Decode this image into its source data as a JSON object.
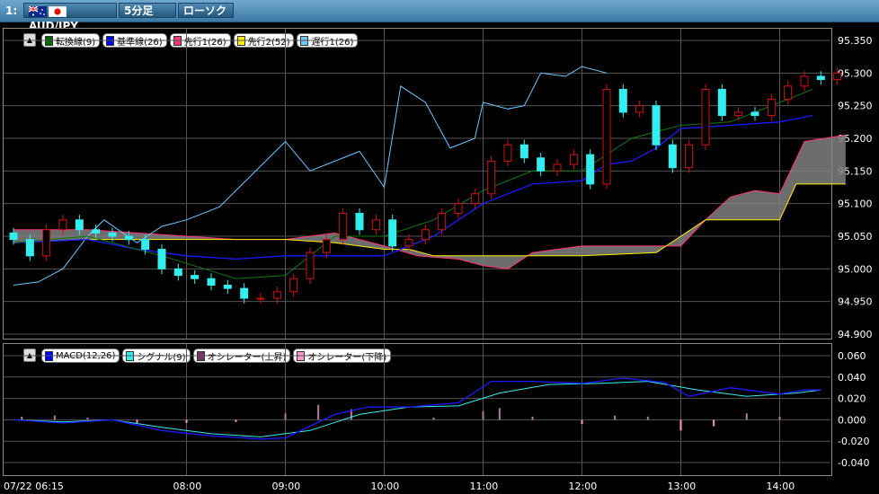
{
  "toolbar": {
    "index": "1:",
    "pair": "AUD/JPY",
    "interval": "5分足",
    "style": "ローソク"
  },
  "main_legend": [
    {
      "label": "転換線(9)",
      "color": "#006400"
    },
    {
      "label": "基準線(26)",
      "color": "#0000ff"
    },
    {
      "label": "先行1(26)",
      "color": "#ff3377"
    },
    {
      "label": "先行2(52)",
      "color": "#ffee00"
    },
    {
      "label": "遅行1(26)",
      "color": "#6ec8ff"
    }
  ],
  "sub_legend": [
    {
      "label": "MACD(12,26)",
      "color": "#0000ff"
    },
    {
      "label": "シグナル(9)",
      "color": "#33eeee"
    },
    {
      "label": "オシレーター(上昇)",
      "color": "#773366"
    },
    {
      "label": "オシレーター(下降)",
      "color": "#ff99cc"
    }
  ],
  "colors": {
    "bull": "#d41010",
    "bear": "#33eeee",
    "cloud": "#808080"
  },
  "chart_data": [
    {
      "type": "candlestick",
      "title": "AUD/JPY 5分足",
      "ylim": [
        94.88,
        95.37
      ],
      "y_ticks": [
        "95.350",
        "95.300",
        "95.250",
        "95.200",
        "95.150",
        "95.100",
        "95.050",
        "95.000",
        "94.950",
        "94.900"
      ],
      "x_ticks": [
        "07/22 06:15",
        "08:00",
        "09:00",
        "10:00",
        "11:00",
        "12:00",
        "13:00",
        "14:00"
      ],
      "x_range": [
        "06:15",
        "14:40"
      ],
      "close_series": [
        [
          "06:15",
          95.045
        ],
        [
          "06:25",
          95.02
        ],
        [
          "06:35",
          95.06
        ],
        [
          "06:45",
          95.075
        ],
        [
          "06:55",
          95.06
        ],
        [
          "07:05",
          95.055
        ],
        [
          "07:15",
          95.05
        ],
        [
          "07:25",
          95.045
        ],
        [
          "07:35",
          95.03
        ],
        [
          "07:45",
          95.0
        ],
        [
          "07:55",
          94.99
        ],
        [
          "08:05",
          94.985
        ],
        [
          "08:15",
          94.975
        ],
        [
          "08:25",
          94.97
        ],
        [
          "08:35",
          94.955
        ],
        [
          "08:45",
          94.955
        ],
        [
          "08:55",
          94.965
        ],
        [
          "09:05",
          94.985
        ],
        [
          "09:15",
          95.025
        ],
        [
          "09:25",
          95.045
        ],
        [
          "09:35",
          95.085
        ],
        [
          "09:45",
          95.06
        ],
        [
          "09:55",
          95.075
        ],
        [
          "10:05",
          95.035
        ],
        [
          "10:15",
          95.045
        ],
        [
          "10:25",
          95.06
        ],
        [
          "10:35",
          95.085
        ],
        [
          "10:45",
          95.1
        ],
        [
          "10:55",
          95.115
        ],
        [
          "11:05",
          95.165
        ],
        [
          "11:15",
          95.19
        ],
        [
          "11:25",
          95.17
        ],
        [
          "11:35",
          95.15
        ],
        [
          "11:45",
          95.16
        ],
        [
          "11:55",
          95.175
        ],
        [
          "12:05",
          95.13
        ],
        [
          "12:15",
          95.275
        ],
        [
          "12:25",
          95.24
        ],
        [
          "12:35",
          95.25
        ],
        [
          "12:45",
          95.19
        ],
        [
          "12:55",
          95.155
        ],
        [
          "13:05",
          95.19
        ],
        [
          "13:15",
          95.275
        ],
        [
          "13:25",
          95.235
        ],
        [
          "13:35",
          95.24
        ],
        [
          "13:45",
          95.235
        ],
        [
          "13:55",
          95.26
        ],
        [
          "14:05",
          95.28
        ],
        [
          "14:15",
          95.295
        ],
        [
          "14:25",
          95.29
        ],
        [
          "14:35",
          95.3
        ]
      ],
      "kijun_26": [
        [
          "06:15",
          95.04
        ],
        [
          "07:00",
          95.045
        ],
        [
          "07:30",
          95.03
        ],
        [
          "08:00",
          95.02
        ],
        [
          "08:30",
          95.015
        ],
        [
          "09:00",
          95.02
        ],
        [
          "09:30",
          95.02
        ],
        [
          "10:00",
          95.02
        ],
        [
          "10:30",
          95.05
        ],
        [
          "11:00",
          95.1
        ],
        [
          "11:30",
          95.13
        ],
        [
          "12:00",
          95.135
        ],
        [
          "12:15",
          95.16
        ],
        [
          "12:30",
          95.165
        ],
        [
          "12:45",
          95.185
        ],
        [
          "13:00",
          95.215
        ],
        [
          "13:30",
          95.22
        ],
        [
          "14:00",
          95.225
        ],
        [
          "14:20",
          95.235
        ]
      ],
      "tenkan_9": [
        [
          "06:15",
          95.04
        ],
        [
          "07:00",
          95.05
        ],
        [
          "07:45",
          95.02
        ],
        [
          "08:30",
          94.985
        ],
        [
          "09:00",
          94.99
        ],
        [
          "09:30",
          95.05
        ],
        [
          "10:00",
          95.05
        ],
        [
          "10:30",
          95.075
        ],
        [
          "11:00",
          95.12
        ],
        [
          "11:30",
          95.15
        ],
        [
          "12:00",
          95.15
        ],
        [
          "12:30",
          95.2
        ],
        [
          "13:00",
          95.22
        ],
        [
          "13:30",
          95.225
        ],
        [
          "14:00",
          95.255
        ],
        [
          "14:20",
          95.275
        ]
      ],
      "senkou1_26": [
        [
          "06:15",
          95.06
        ],
        [
          "07:00",
          95.06
        ],
        [
          "07:30",
          95.055
        ],
        [
          "08:00",
          95.05
        ],
        [
          "08:30",
          95.045
        ],
        [
          "09:00",
          95.045
        ],
        [
          "09:30",
          95.055
        ],
        [
          "10:00",
          95.035
        ],
        [
          "10:20",
          95.02
        ],
        [
          "10:45",
          95.015
        ],
        [
          "11:00",
          95.005
        ],
        [
          "11:15",
          95.0
        ],
        [
          "11:30",
          95.025
        ],
        [
          "12:00",
          95.035
        ],
        [
          "12:30",
          95.035
        ],
        [
          "13:00",
          95.035
        ],
        [
          "13:15",
          95.075
        ],
        [
          "13:30",
          95.11
        ],
        [
          "13:45",
          95.12
        ],
        [
          "14:00",
          95.115
        ],
        [
          "14:15",
          95.195
        ],
        [
          "14:40",
          95.205
        ]
      ],
      "senkou2_52": [
        [
          "06:15",
          95.04
        ],
        [
          "07:00",
          95.045
        ],
        [
          "07:30",
          95.045
        ],
        [
          "08:00",
          95.045
        ],
        [
          "08:30",
          95.045
        ],
        [
          "09:00",
          95.045
        ],
        [
          "09:30",
          95.04
        ],
        [
          "10:00",
          95.03
        ],
        [
          "10:15",
          95.03
        ],
        [
          "10:30",
          95.02
        ],
        [
          "11:00",
          95.02
        ],
        [
          "12:00",
          95.02
        ],
        [
          "12:45",
          95.025
        ],
        [
          "13:00",
          95.05
        ],
        [
          "13:15",
          95.075
        ],
        [
          "14:00",
          95.075
        ],
        [
          "14:10",
          95.13
        ],
        [
          "14:40",
          95.13
        ]
      ],
      "chikou_26": [
        [
          "06:15",
          94.975
        ],
        [
          "06:30",
          94.98
        ],
        [
          "06:45",
          95.0
        ],
        [
          "07:00",
          95.05
        ],
        [
          "07:10",
          95.075
        ],
        [
          "07:30",
          95.04
        ],
        [
          "07:45",
          95.065
        ],
        [
          "08:00",
          95.075
        ],
        [
          "08:20",
          95.095
        ],
        [
          "08:40",
          95.145
        ],
        [
          "09:00",
          95.195
        ],
        [
          "09:15",
          95.15
        ],
        [
          "09:30",
          95.165
        ],
        [
          "09:45",
          95.18
        ],
        [
          "10:00",
          95.125
        ],
        [
          "10:10",
          95.28
        ],
        [
          "10:25",
          95.255
        ],
        [
          "10:40",
          95.185
        ],
        [
          "10:55",
          95.2
        ],
        [
          "11:00",
          95.255
        ],
        [
          "11:15",
          95.245
        ],
        [
          "11:25",
          95.25
        ],
        [
          "11:35",
          95.3
        ],
        [
          "11:50",
          95.295
        ],
        [
          "12:00",
          95.31
        ],
        [
          "12:15",
          95.3
        ]
      ]
    },
    {
      "type": "line",
      "title": "MACD(12,26)",
      "ylim": [
        -0.05,
        0.065
      ],
      "y_ticks": [
        "0.060",
        "0.040",
        "0.020",
        "0.000",
        "-0.020",
        "-0.040"
      ],
      "macd": [
        [
          "06:15",
          0.0
        ],
        [
          "06:45",
          -0.003
        ],
        [
          "07:15",
          0.0
        ],
        [
          "07:45",
          -0.01
        ],
        [
          "08:15",
          -0.015
        ],
        [
          "08:45",
          -0.018
        ],
        [
          "09:00",
          -0.017
        ],
        [
          "09:30",
          0.005
        ],
        [
          "09:50",
          0.012
        ],
        [
          "10:15",
          0.012
        ],
        [
          "10:45",
          0.016
        ],
        [
          "11:05",
          0.036
        ],
        [
          "11:30",
          0.036
        ],
        [
          "12:00",
          0.034
        ],
        [
          "12:25",
          0.039
        ],
        [
          "12:50",
          0.035
        ],
        [
          "13:05",
          0.022
        ],
        [
          "13:30",
          0.03
        ],
        [
          "14:00",
          0.024
        ],
        [
          "14:15",
          0.028
        ],
        [
          "14:25",
          0.028
        ]
      ],
      "signal": [
        [
          "06:15",
          0.0
        ],
        [
          "06:45",
          -0.002
        ],
        [
          "07:15",
          0.0
        ],
        [
          "07:45",
          -0.007
        ],
        [
          "08:15",
          -0.013
        ],
        [
          "08:45",
          -0.016
        ],
        [
          "09:15",
          -0.01
        ],
        [
          "09:45",
          0.005
        ],
        [
          "10:15",
          0.012
        ],
        [
          "10:45",
          0.013
        ],
        [
          "11:10",
          0.025
        ],
        [
          "11:40",
          0.033
        ],
        [
          "12:10",
          0.034
        ],
        [
          "12:40",
          0.036
        ],
        [
          "13:10",
          0.028
        ],
        [
          "13:40",
          0.022
        ],
        [
          "14:10",
          0.025
        ],
        [
          "14:25",
          0.028
        ]
      ],
      "oscillator": [
        [
          "06:20",
          0.003
        ],
        [
          "06:40",
          0.004
        ],
        [
          "07:00",
          0.002
        ],
        [
          "07:30",
          -0.003
        ],
        [
          "08:00",
          -0.003
        ],
        [
          "08:30",
          -0.002
        ],
        [
          "09:00",
          0.006
        ],
        [
          "09:20",
          0.014
        ],
        [
          "09:40",
          0.01
        ],
        [
          "10:00",
          0.0
        ],
        [
          "10:30",
          0.002
        ],
        [
          "11:00",
          0.008
        ],
        [
          "11:10",
          0.011
        ],
        [
          "11:30",
          0.003
        ],
        [
          "12:00",
          -0.004
        ],
        [
          "12:20",
          0.004
        ],
        [
          "12:40",
          0.003
        ],
        [
          "13:00",
          -0.01
        ],
        [
          "13:20",
          -0.006
        ],
        [
          "13:40",
          0.006
        ],
        [
          "14:00",
          0.003
        ]
      ]
    }
  ]
}
